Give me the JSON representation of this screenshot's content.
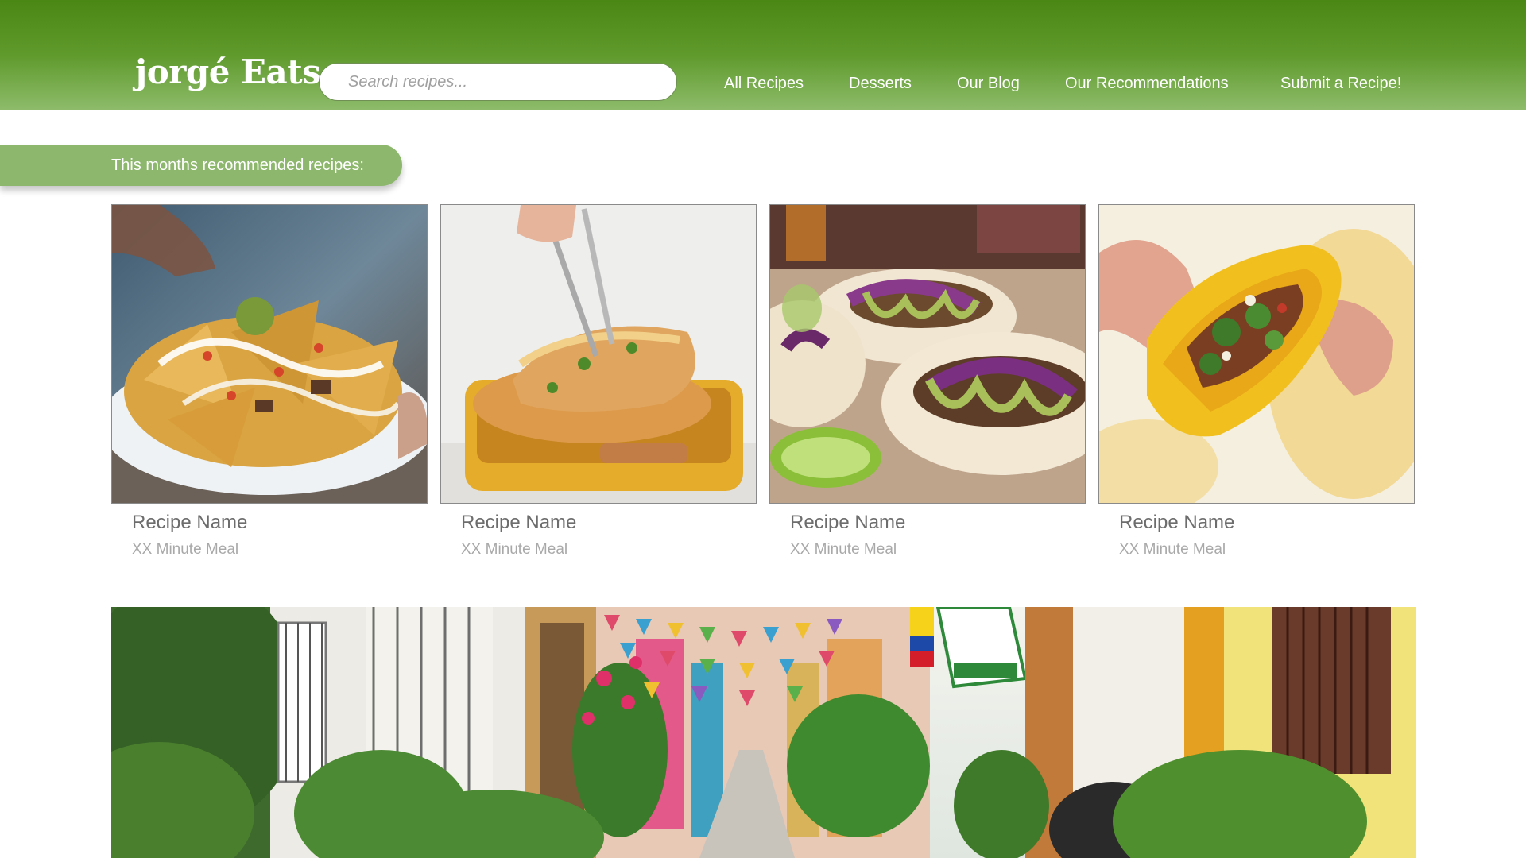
{
  "header": {
    "logo": "jorgé Eats",
    "search_placeholder": "Search recipes...",
    "nav": [
      "All Recipes",
      "Desserts",
      "Our Blog",
      "Our Recommendations",
      "Submit a Recipe!"
    ]
  },
  "section": {
    "recommended_label": "This months recommended recipes:"
  },
  "cards": [
    {
      "name": "Recipe Name",
      "meta": "XX Minute Meal",
      "image": "nachos-photo"
    },
    {
      "name": "Recipe Name",
      "meta": "XX Minute Meal",
      "image": "enchiladas-photo"
    },
    {
      "name": "Recipe Name",
      "meta": "XX Minute Meal",
      "image": "tacos-photo"
    },
    {
      "name": "Recipe Name",
      "meta": "XX Minute Meal",
      "image": "taco-in-hand-photo"
    }
  ],
  "banner": {
    "image": "colorful-street-photo"
  },
  "colors": {
    "header_green": "#4a8714",
    "pill_green": "#8db76d",
    "name_gray": "#6d6d6d",
    "meta_gray": "#a9a9a9"
  }
}
